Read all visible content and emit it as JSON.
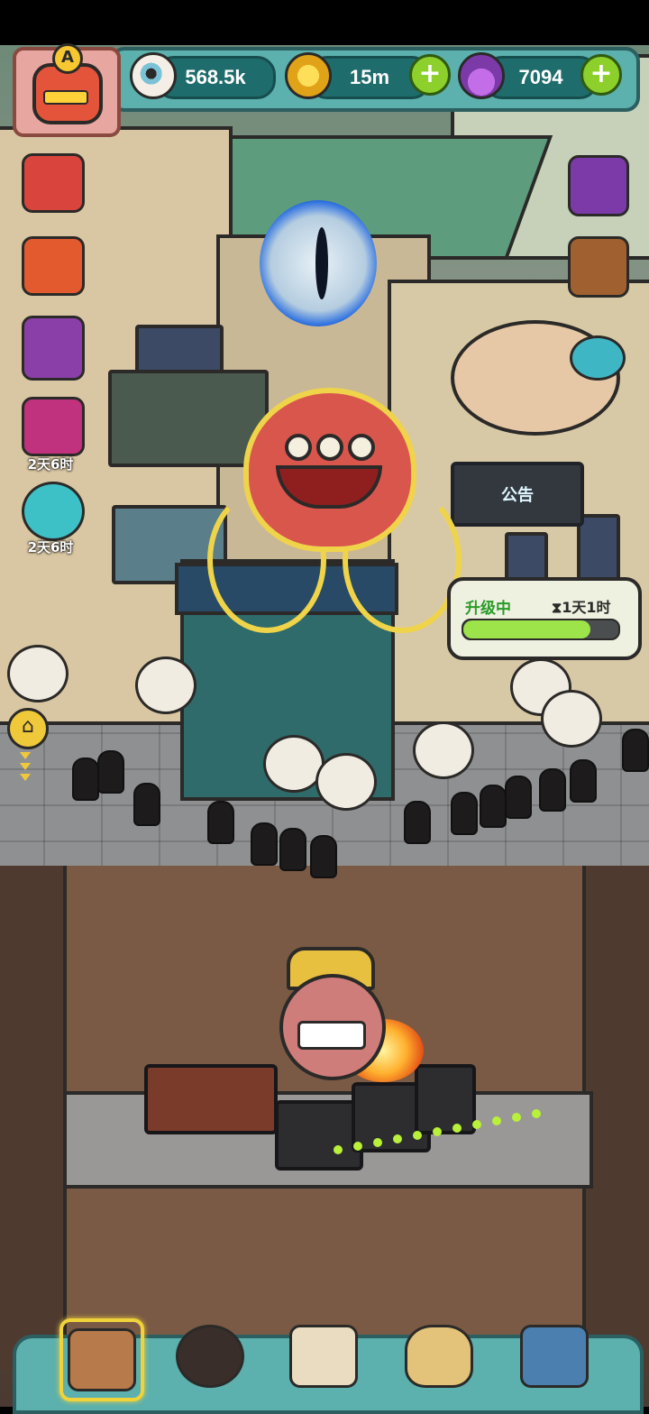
{
  "resources": {
    "eyeballs": "568.5k",
    "coins": "15m",
    "potions": "7094",
    "plus_symbol": "+"
  },
  "avatar": {
    "rank_letter": "A"
  },
  "side_timers": {
    "gift_timer": "2天6时",
    "monster_timer": "2天6时"
  },
  "announcement": "公告",
  "upgrade": {
    "label": "升级中",
    "time_left": "1天1时",
    "hourglass_icon": "⧗",
    "progress": 0.82
  },
  "colors": {
    "hud": "#5cb0ad",
    "plus": "#8dcf2b",
    "upgrade_green": "#2b9b2a"
  },
  "icons": {
    "top": [
      "eyeball-icon",
      "coin-icon",
      "potion-icon"
    ],
    "left": [
      "gift-box-icon",
      "fruit-gift-icon",
      "cards-icon",
      "gold-gift-icon",
      "monster-gift-icon",
      "home-icon"
    ],
    "right": [
      "video-tv-icon",
      "backpack-icon"
    ],
    "bottom": [
      "restaurant-icon",
      "monster-icon",
      "recipe-book-icon",
      "money-bag-icon",
      "grid-menu-icon"
    ]
  }
}
